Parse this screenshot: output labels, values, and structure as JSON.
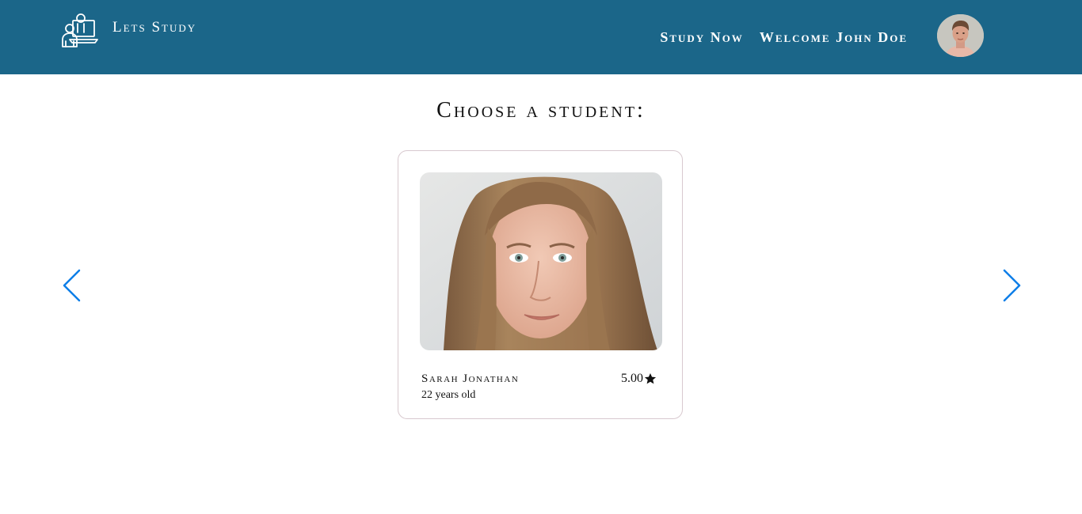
{
  "brand": {
    "name": "Lets Study",
    "icon": "teacher-laptop-icon"
  },
  "nav": {
    "links": [
      {
        "label": "Study Now"
      },
      {
        "label": "Welcome John Doe"
      }
    ],
    "avatar_icon": "user-avatar"
  },
  "page": {
    "title": "Choose a student:"
  },
  "carousel": {
    "prev_icon": "chevron-left-icon",
    "next_icon": "chevron-right-icon",
    "arrow_color": "#0d7ee8"
  },
  "student": {
    "name": "Sarah Jonathan",
    "age": "22 years old",
    "rating": "5.00",
    "rating_icon": "star-icon"
  },
  "colors": {
    "header_bg": "#1b6689",
    "card_border": "#d8c9cf"
  }
}
